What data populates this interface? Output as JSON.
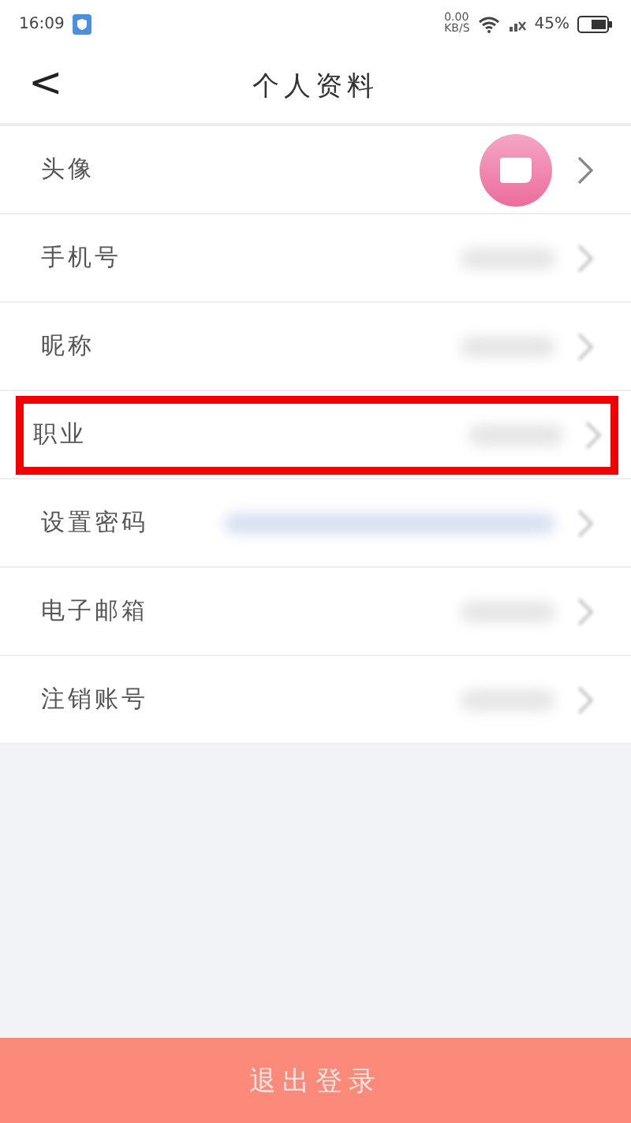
{
  "status_bar": {
    "time": "16:09",
    "speed": "0.00",
    "speed_unit": "KB/S",
    "battery": "45%"
  },
  "header": {
    "back": "<",
    "title": "个人资料"
  },
  "rows": [
    {
      "kind": "avatar",
      "label": "头像",
      "highlighted": false
    },
    {
      "kind": "value",
      "label": "手机号",
      "highlighted": false
    },
    {
      "kind": "value",
      "label": "昵称",
      "highlighted": false
    },
    {
      "kind": "value",
      "label": "职业",
      "highlighted": true
    },
    {
      "kind": "link",
      "label": "设置密码",
      "highlighted": false
    },
    {
      "kind": "value",
      "label": "电子邮箱",
      "highlighted": false
    },
    {
      "kind": "value",
      "label": "注销账号",
      "highlighted": false
    }
  ],
  "logout_button": "退出登录"
}
